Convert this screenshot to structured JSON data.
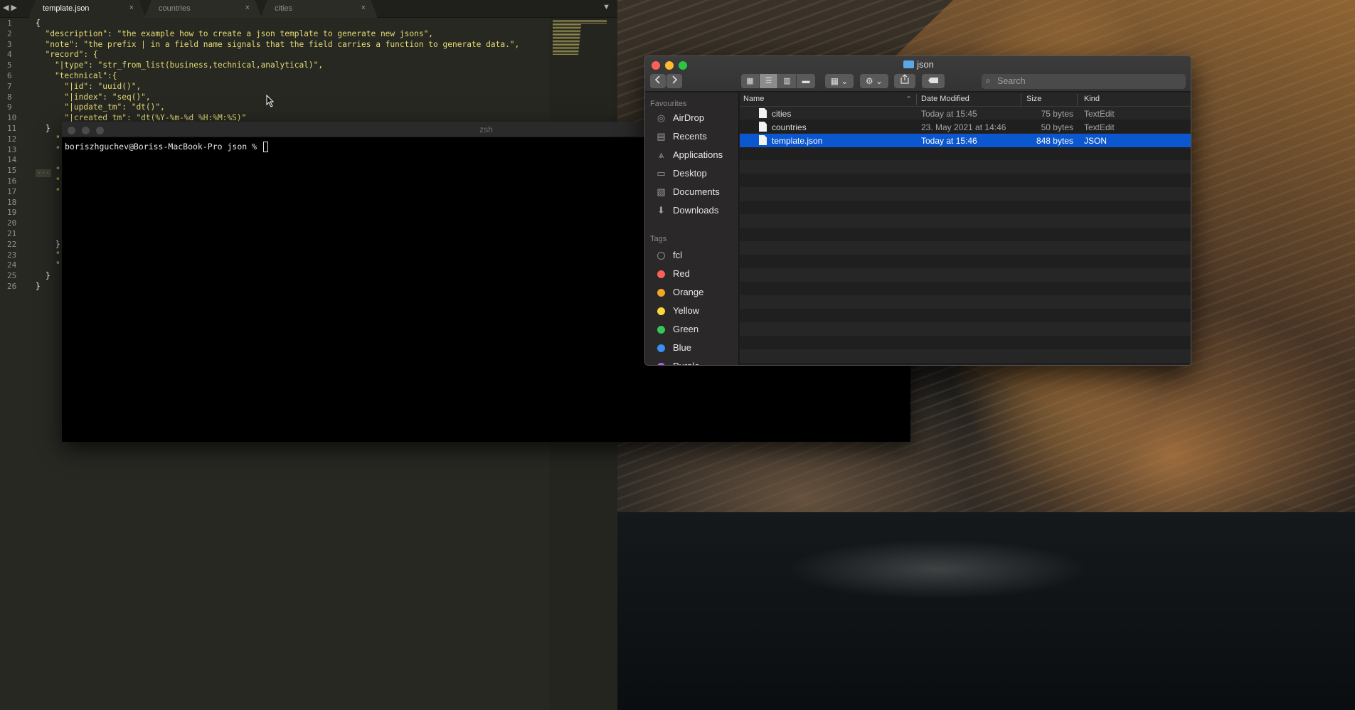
{
  "editor": {
    "nav_arrows": "◀ ▶",
    "tabs": [
      {
        "label": "template.json",
        "active": true
      },
      {
        "label": "countries",
        "active": false
      },
      {
        "label": "cities",
        "active": false
      }
    ],
    "close_glyph": "×",
    "dropdown_glyph": "▼",
    "line_numbers": [
      "1",
      "2",
      "3",
      "4",
      "5",
      "6",
      "7",
      "8",
      "9",
      "10",
      "11",
      "12",
      "13",
      "14",
      "15",
      "16",
      "17",
      "18",
      "19",
      "20",
      "21",
      "22",
      "23",
      "24",
      "25",
      "26"
    ],
    "code_lines": [
      "{",
      "  \"description\": \"the example how to create a json template to generate new jsons\",",
      "  \"note\": \"the prefix | in a field name signals that the field carries a function to generate data.\",",
      "  \"record\": {",
      "    \"|type\": \"str_from_list(business,technical,analytical)\",",
      "    \"technical\":{",
      "      \"|id\": \"uuid()\",",
      "      \"|index\": \"seq()\",",
      "      \"|update_tm\": \"dt()\",",
      "      \"|created_tm\": \"dt(%Y-%m-%d %H:%M:%S)\""
    ],
    "hidden_fragments": [
      "}",
      "\"",
      "\"",
      "\"",
      "\"",
      "\"",
      "}",
      "\"",
      "\"",
      "}",
      "}"
    ],
    "fold_marker": "···"
  },
  "terminal": {
    "title": "zsh",
    "prompt": "boriszhguchev@Boriss-MacBook-Pro json % "
  },
  "finder": {
    "title": "json",
    "search_placeholder": "Search",
    "sidebar": {
      "favourites_header": "Favourites",
      "favourites": [
        {
          "label": "AirDrop",
          "icon": "airdrop-icon",
          "glyph": "◎"
        },
        {
          "label": "Recents",
          "icon": "recents-icon",
          "glyph": "▤"
        },
        {
          "label": "Applications",
          "icon": "applications-icon",
          "glyph": "⩓"
        },
        {
          "label": "Desktop",
          "icon": "desktop-icon",
          "glyph": "▭"
        },
        {
          "label": "Documents",
          "icon": "documents-icon",
          "glyph": "▧"
        },
        {
          "label": "Downloads",
          "icon": "downloads-icon",
          "glyph": "⬇"
        }
      ],
      "tags_header": "Tags",
      "tags": [
        {
          "label": "fcl",
          "color": "#2a2828",
          "border": "#8a8a8a"
        },
        {
          "label": "Red",
          "color": "#fe5f57"
        },
        {
          "label": "Orange",
          "color": "#f5a623"
        },
        {
          "label": "Yellow",
          "color": "#f8d93a"
        },
        {
          "label": "Green",
          "color": "#34c759"
        },
        {
          "label": "Blue",
          "color": "#3b8ef3"
        },
        {
          "label": "Purple",
          "color": "#bf5af2"
        }
      ]
    },
    "columns": {
      "name": "Name",
      "date": "Date Modified",
      "size": "Size",
      "kind": "Kind"
    },
    "files": [
      {
        "name": "cities",
        "date": "Today at 15:45",
        "size": "75 bytes",
        "kind": "TextEdit",
        "selected": false
      },
      {
        "name": "countries",
        "date": "23. May 2021 at 14:46",
        "size": "50 bytes",
        "kind": "TextEdit",
        "selected": false
      },
      {
        "name": "template.json",
        "date": "Today at 15:46",
        "size": "848 bytes",
        "kind": "JSON",
        "selected": true
      }
    ],
    "sort_glyph": "⌃"
  }
}
